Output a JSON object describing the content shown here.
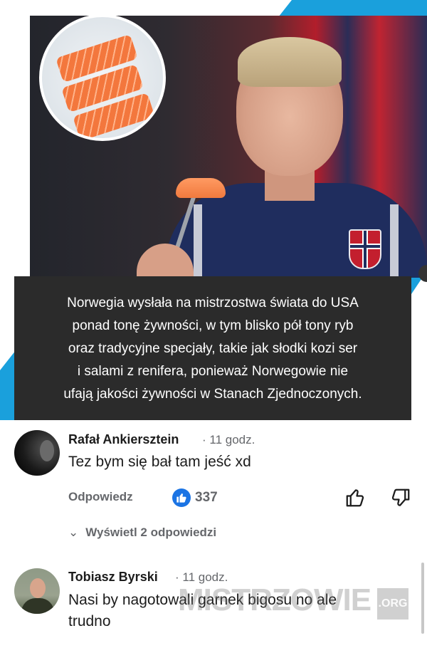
{
  "post": {
    "caption_lines": [
      "Norwegia wysłała na mistrzostwa świata do USA",
      "ponad tonę żywności, w tym blisko pół tony ryb",
      "oraz tradycyjne specjały, takie jak słodki kozi ser",
      "i salami z renifera, ponieważ Norwegowie nie",
      "ufają jakości żywności w Stanach Zjednoczonych."
    ]
  },
  "comments": [
    {
      "author": "Rafał Ankiersztein",
      "time": "· 11 godz.",
      "text": "Tez bym się bał tam jeść xd",
      "reply_label": "Odpowiedz",
      "like_count": "337",
      "view_replies": "Wyświetl 2 odpowiedzi"
    },
    {
      "author": "Tobiasz Byrski",
      "time": "· 11 godz.",
      "text_lines": [
        "Nasi by nagotowali garnek bigosu no ale",
        "trudno"
      ]
    }
  ],
  "watermark": {
    "text": "MISTRZOWIE",
    "suffix": ".ORG"
  },
  "colors": {
    "accent_blue": "#1b74e4",
    "caption_bg": "#2b2b2b",
    "post_bg_blue": "#1aa0dc"
  },
  "icons": [
    "thumbs-up-icon",
    "thumbs-down-icon",
    "chevron-down-icon",
    "like-reaction-icon"
  ]
}
